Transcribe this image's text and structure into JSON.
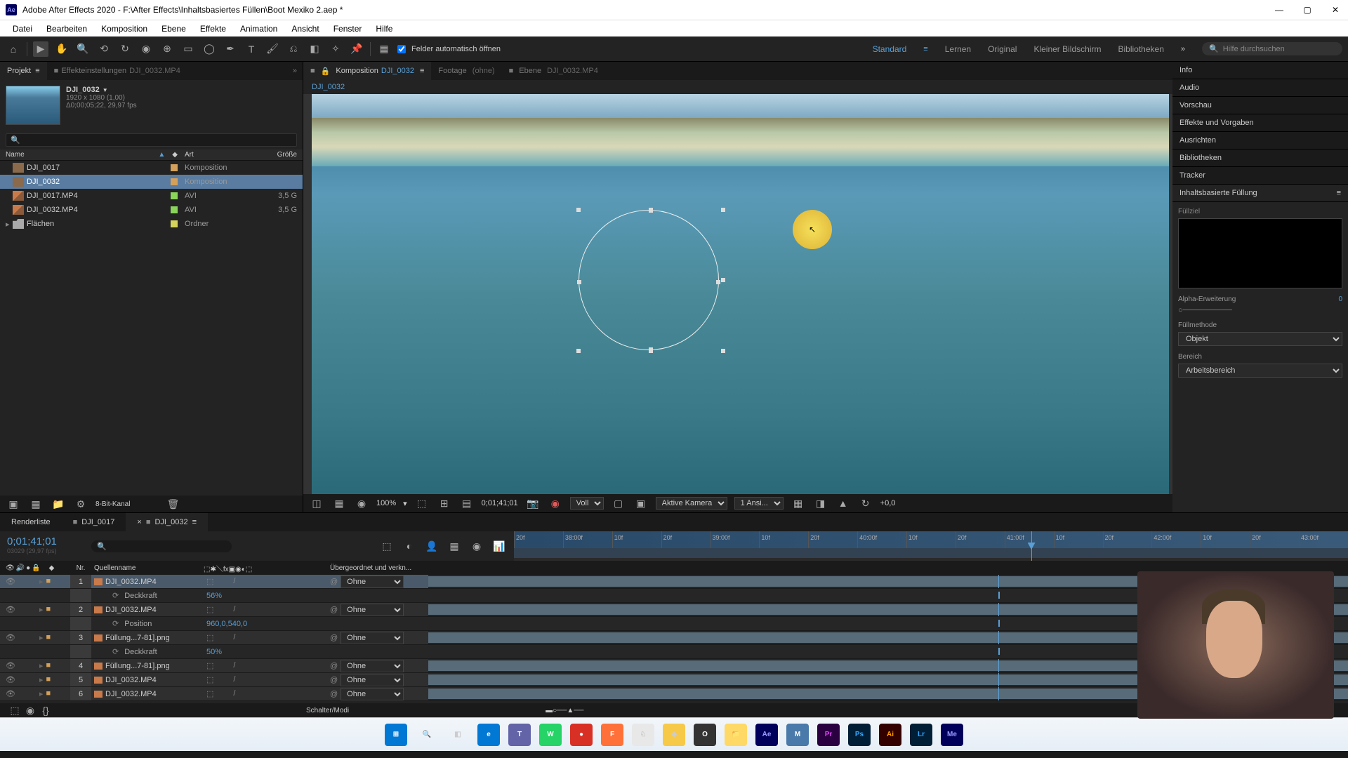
{
  "titlebar": {
    "app_icon": "Ae",
    "title": "Adobe After Effects 2020 - F:\\After Effects\\Inhaltsbasiertes Füllen\\Boot Mexiko 2.aep *"
  },
  "menubar": [
    "Datei",
    "Bearbeiten",
    "Komposition",
    "Ebene",
    "Effekte",
    "Animation",
    "Ansicht",
    "Fenster",
    "Hilfe"
  ],
  "toolbar": {
    "auto_open_label": "Felder automatisch öffnen",
    "workspaces": [
      "Standard",
      "Lernen",
      "Original",
      "Kleiner Bildschirm",
      "Bibliotheken"
    ],
    "workspace_active": "Standard",
    "search_placeholder": "Hilfe durchsuchen"
  },
  "project": {
    "tab_project": "Projekt",
    "tab_effects": "Effekteinstellungen",
    "tab_effects_suffix": "DJI_0032.MP4",
    "selected_name": "DJI_0032",
    "resolution": "1920 x 1080 (1,00)",
    "duration": "Δ0;00;05;22, 29,97 fps",
    "col_name": "Name",
    "col_type": "Art",
    "col_size": "Größe",
    "items": [
      {
        "name": "DJI_0017",
        "type": "Komposition",
        "size": "",
        "icon": "comp",
        "label": "#d4a05a"
      },
      {
        "name": "DJI_0032",
        "type": "Komposition",
        "size": "",
        "icon": "comp",
        "label": "#d4a05a",
        "selected": true
      },
      {
        "name": "DJI_0017.MP4",
        "type": "AVI",
        "size": "3,5 G",
        "icon": "avi",
        "label": "#8ad45a"
      },
      {
        "name": "DJI_0032.MP4",
        "type": "AVI",
        "size": "3,5 G",
        "icon": "avi",
        "label": "#8ad45a"
      },
      {
        "name": "Flächen",
        "type": "Ordner",
        "size": "",
        "icon": "folder",
        "label": "#d4d45a",
        "expandable": true
      }
    ],
    "footer_depth": "8-Bit-Kanal"
  },
  "viewer": {
    "tab_comp_prefix": "Komposition",
    "tab_comp_name": "DJI_0032",
    "tab_footage": "Footage",
    "tab_footage_suffix": "(ohne)",
    "tab_layer_prefix": "Ebene",
    "tab_layer_name": "DJI_0032.MP4",
    "breadcrumb": "DJI_0032",
    "zoom": "100%",
    "timecode": "0;01;41;01",
    "resolution": "Voll",
    "camera": "Aktive Kamera",
    "views": "1 Ansi...",
    "exposure": "+0,0"
  },
  "right": {
    "tabs": [
      "Info",
      "Audio",
      "Vorschau",
      "Effekte und Vorgaben",
      "Ausrichten",
      "Bibliotheken",
      "Tracker"
    ],
    "fill_title": "Inhaltsbasierte Füllung",
    "fill_target_label": "Füllziel",
    "alpha_label": "Alpha-Erweiterung",
    "alpha_value": "0",
    "method_label": "Füllmethode",
    "method_value": "Objekt",
    "range_label": "Bereich",
    "range_value": "Arbeitsbereich"
  },
  "timeline": {
    "tab_render": "Renderliste",
    "tabs": [
      "DJI_0017",
      "DJI_0032"
    ],
    "active_tab": "DJI_0032",
    "timecode": "0;01;41;01",
    "frames": "03029 (29,97 fps)",
    "col_num": "Nr.",
    "col_source": "Quellenname",
    "col_parent": "Übergeordnet und verkn...",
    "ruler": [
      "20f",
      "38:00f",
      "10f",
      "20f",
      "39:00f",
      "10f",
      "20f",
      "40:00f",
      "10f",
      "20f",
      "41:00f",
      "10f",
      "20f",
      "42:00f",
      "10f",
      "20f",
      "43:00f"
    ],
    "layers": [
      {
        "num": "1",
        "name": "DJI_0032.MP4",
        "parent": "Ohne",
        "selected": true
      },
      {
        "prop": true,
        "name": "Deckkraft",
        "value": "56%"
      },
      {
        "num": "2",
        "name": "DJI_0032.MP4",
        "parent": "Ohne"
      },
      {
        "prop": true,
        "name": "Position",
        "value": "960,0,540,0"
      },
      {
        "num": "3",
        "name": "Füllung...7-81].png",
        "parent": "Ohne"
      },
      {
        "prop": true,
        "name": "Deckkraft",
        "value": "50%"
      },
      {
        "num": "4",
        "name": "Füllung...7-81].png",
        "parent": "Ohne"
      },
      {
        "num": "5",
        "name": "DJI_0032.MP4",
        "parent": "Ohne"
      },
      {
        "num": "6",
        "name": "DJI_0032.MP4",
        "parent": "Ohne"
      }
    ],
    "footer": "Schalter/Modi"
  },
  "taskbar": {
    "icons": [
      {
        "name": "windows",
        "bg": "#0078d4",
        "txt": "⊞",
        "color": "#fff"
      },
      {
        "name": "search",
        "bg": "transparent",
        "txt": "🔍"
      },
      {
        "name": "taskview",
        "bg": "transparent",
        "txt": "◧"
      },
      {
        "name": "edge",
        "bg": "#0078d4",
        "txt": "e",
        "color": "#fff"
      },
      {
        "name": "teams",
        "bg": "#6264a7",
        "txt": "T",
        "color": "#fff"
      },
      {
        "name": "whatsapp",
        "bg": "#25d366",
        "txt": "W",
        "color": "#fff"
      },
      {
        "name": "app1",
        "bg": "#d93025",
        "txt": "●",
        "color": "#fff"
      },
      {
        "name": "firefox",
        "bg": "#ff7139",
        "txt": "F",
        "color": "#fff"
      },
      {
        "name": "app2",
        "bg": "#e8e8e8",
        "txt": "♘"
      },
      {
        "name": "app3",
        "bg": "#f7c948",
        "txt": "◆"
      },
      {
        "name": "obs",
        "bg": "#333",
        "txt": "O",
        "color": "#fff"
      },
      {
        "name": "explorer",
        "bg": "#ffd966",
        "txt": "📁"
      },
      {
        "name": "aftereffects",
        "bg": "#00005b",
        "txt": "Ae",
        "color": "#9999ff"
      },
      {
        "name": "app4",
        "bg": "#4a7aaa",
        "txt": "M",
        "color": "#fff"
      },
      {
        "name": "premiere",
        "bg": "#2a0040",
        "txt": "Pr",
        "color": "#e040fb"
      },
      {
        "name": "photoshop",
        "bg": "#001e36",
        "txt": "Ps",
        "color": "#31a8ff"
      },
      {
        "name": "illustrator",
        "bg": "#330000",
        "txt": "Ai",
        "color": "#ff9a00"
      },
      {
        "name": "lightroom",
        "bg": "#001e36",
        "txt": "Lr",
        "color": "#31a8ff"
      },
      {
        "name": "mediaencoder",
        "bg": "#00005b",
        "txt": "Me",
        "color": "#9999ff"
      }
    ]
  }
}
